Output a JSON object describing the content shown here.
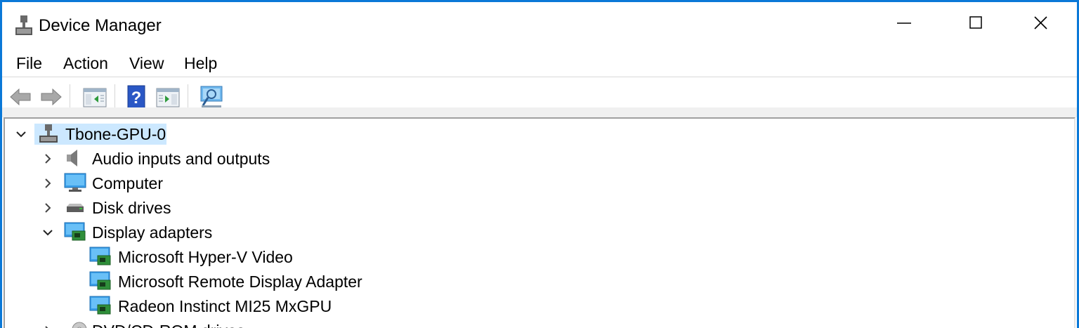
{
  "window": {
    "title": "Device Manager"
  },
  "menu": [
    "File",
    "Action",
    "View",
    "Help"
  ],
  "toolbar": {
    "buttons": [
      "back-icon",
      "forward-icon",
      "show-hide-console-tree-icon",
      "help-icon",
      "action-pane-icon",
      "scan-hardware-icon"
    ]
  },
  "tree": {
    "root": "Tbone-GPU-0",
    "categories": [
      {
        "label": "Audio inputs and outputs",
        "expanded": false
      },
      {
        "label": "Computer",
        "expanded": false
      },
      {
        "label": "Disk drives",
        "expanded": false
      },
      {
        "label": "Display adapters",
        "expanded": true
      },
      {
        "label": "DVD/CD-ROM drives",
        "expanded": false
      }
    ],
    "display_adapters": [
      "Microsoft Hyper-V Video",
      "Microsoft Remote Display Adapter",
      "Radeon Instinct MI25 MxGPU"
    ]
  },
  "colors": {
    "border_accent": "#0a78d7",
    "selection": "#cce8ff"
  }
}
